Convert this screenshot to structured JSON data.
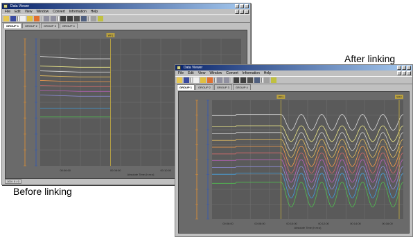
{
  "captions": {
    "before": "Before linking",
    "after": "After linking"
  },
  "window": {
    "title": "Data Viewer",
    "menu": [
      "File",
      "Edit",
      "View",
      "Window",
      "Convert",
      "Information",
      "Help"
    ],
    "tabs": [
      "GROUP 1",
      "GROUP 2",
      "GROUP 3",
      "GROUP 4"
    ],
    "active_tab": 0,
    "toolbar_icons": [
      "open-icon",
      "save-icon",
      "copy-icon",
      "folder-icon",
      "star-icon",
      "zoom-in-icon",
      "zoom-out-icon",
      "channel-icon",
      "display-icon",
      "math-icon",
      "cursor-icon",
      "print-icon",
      "help-icon"
    ]
  },
  "before_chart": {
    "marker_label": "WF1",
    "x_ticks": [
      "00:06:00",
      "00:08:00",
      "00:10:00",
      "00:12:00"
    ],
    "x_axis_label": "Absolute Time (h:m:s)",
    "status": "100 / 0 / 0"
  },
  "after_chart": {
    "marker_labels": [
      "WF1",
      "WF2"
    ],
    "x_ticks": [
      "00:06:00",
      "00:08:00",
      "00:10:00",
      "00:12:00",
      "00:14:00",
      "00:16:00"
    ],
    "x_axis_label": "Absolute Time (h:m:s)"
  },
  "colors": {
    "plot_bg": "#5a5a5a",
    "grid": "#707070",
    "axis_left": "#d08a3a",
    "axis_inner": "#3a5aa8",
    "marker": "#c8b040",
    "trace_colors": [
      "#e0e0e0",
      "#f4ef8a",
      "#d6d6d6",
      "#e8c060",
      "#ffa04a",
      "#d86a6a",
      "#c060c0",
      "#9090e0",
      "#40a0e0",
      "#50c050",
      "#e05050"
    ]
  },
  "chart_data": [
    {
      "type": "line",
      "title": "",
      "xlabel": "Absolute Time (h:m:s)",
      "ylabel": "",
      "x_ticks": [
        "00:06:00",
        "00:08:00",
        "00:10:00",
        "00:12:00"
      ],
      "series": [
        {
          "values": [
            [
              0,
              0.38
            ],
            [
              0.55,
              0.36
            ],
            [
              1,
              0.36
            ]
          ]
        },
        {
          "values": [
            [
              0,
              0.3
            ],
            [
              0.55,
              0.29
            ],
            [
              1,
              0.29
            ]
          ]
        },
        {
          "values": [
            [
              0,
              0.26
            ],
            [
              0.55,
              0.25
            ],
            [
              1,
              0.25
            ]
          ]
        },
        {
          "values": [
            [
              0,
              0.22
            ],
            [
              0.55,
              0.21
            ],
            [
              1,
              0.21
            ]
          ]
        },
        {
          "values": [
            [
              0,
              0.18
            ],
            [
              0.55,
              0.17
            ],
            [
              1,
              0.17
            ]
          ]
        },
        {
          "values": [
            [
              0,
              0.14
            ],
            [
              0.55,
              0.13
            ],
            [
              1,
              0.13
            ]
          ]
        },
        {
          "values": [
            [
              0,
              0.1
            ],
            [
              0.55,
              0.09
            ],
            [
              1,
              0.09
            ]
          ]
        },
        {
          "values": [
            [
              0,
              0.06
            ],
            [
              0.55,
              0.05
            ],
            [
              1,
              0.05
            ]
          ]
        },
        {
          "values": [
            [
              0,
              -0.05
            ],
            [
              0.55,
              -0.05
            ],
            [
              1,
              -0.05
            ]
          ]
        },
        {
          "values": [
            [
              0,
              -0.12
            ],
            [
              0.55,
              -0.12
            ],
            [
              1,
              -0.12
            ]
          ]
        }
      ]
    },
    {
      "type": "line",
      "title": "",
      "xlabel": "Absolute Time (h:m:s)",
      "ylabel": "",
      "x_ticks": [
        "00:06:00",
        "00:08:00",
        "00:10:00",
        "00:12:00",
        "00:14:00",
        "00:16:00"
      ],
      "series": [
        {
          "base": 0.4,
          "amp": 0.07
        },
        {
          "base": 0.3,
          "amp": 0.07
        },
        {
          "base": 0.24,
          "amp": 0.08
        },
        {
          "base": 0.18,
          "amp": 0.08
        },
        {
          "base": 0.12,
          "amp": 0.09
        },
        {
          "base": 0.06,
          "amp": 0.09
        },
        {
          "base": 0.0,
          "amp": 0.1
        },
        {
          "base": -0.06,
          "amp": 0.1
        },
        {
          "base": -0.12,
          "amp": 0.11
        },
        {
          "base": -0.2,
          "amp": 0.11
        }
      ]
    }
  ]
}
